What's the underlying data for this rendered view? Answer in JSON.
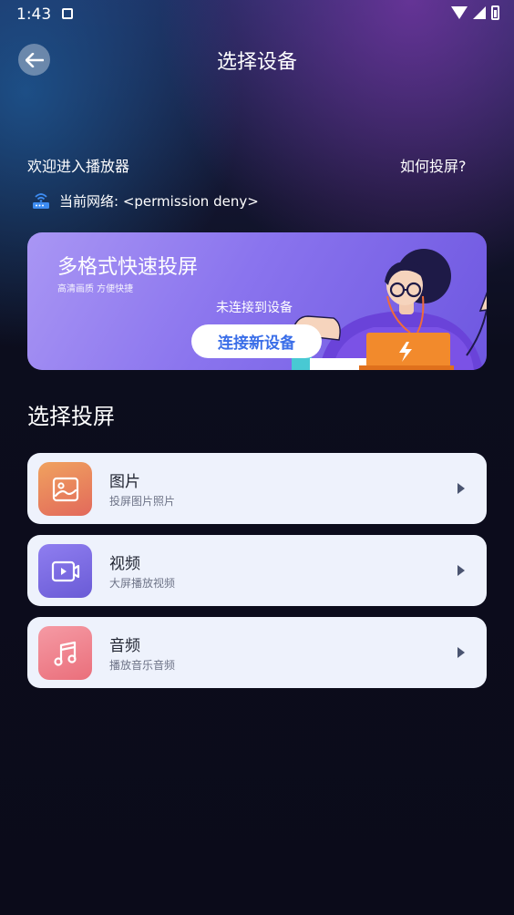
{
  "status_bar": {
    "time": "1:43"
  },
  "header": {
    "title": "选择设备"
  },
  "welcome_text": "欢迎进入播放器",
  "how_to_link": "如何投屏?",
  "network": {
    "label": "当前网络: <permission deny>"
  },
  "banner": {
    "title": "多格式快速投屏",
    "subtitle": "高清画质 方便快捷",
    "status": "未连接到设备",
    "connect_button": "连接新设备"
  },
  "section_title": "选择投屏",
  "cards": [
    {
      "title": "图片",
      "subtitle": "投屏图片照片",
      "icon": "image-icon",
      "color_start": "#f0a25f",
      "color_end": "#e2695b"
    },
    {
      "title": "视频",
      "subtitle": "大屏播放视频",
      "icon": "video-icon",
      "color_start": "#8f7ef0",
      "color_end": "#6a5bd6"
    },
    {
      "title": "音频",
      "subtitle": "播放音乐音频",
      "icon": "music-icon",
      "color_start": "#f59aa4",
      "color_end": "#ea6f7b"
    }
  ]
}
